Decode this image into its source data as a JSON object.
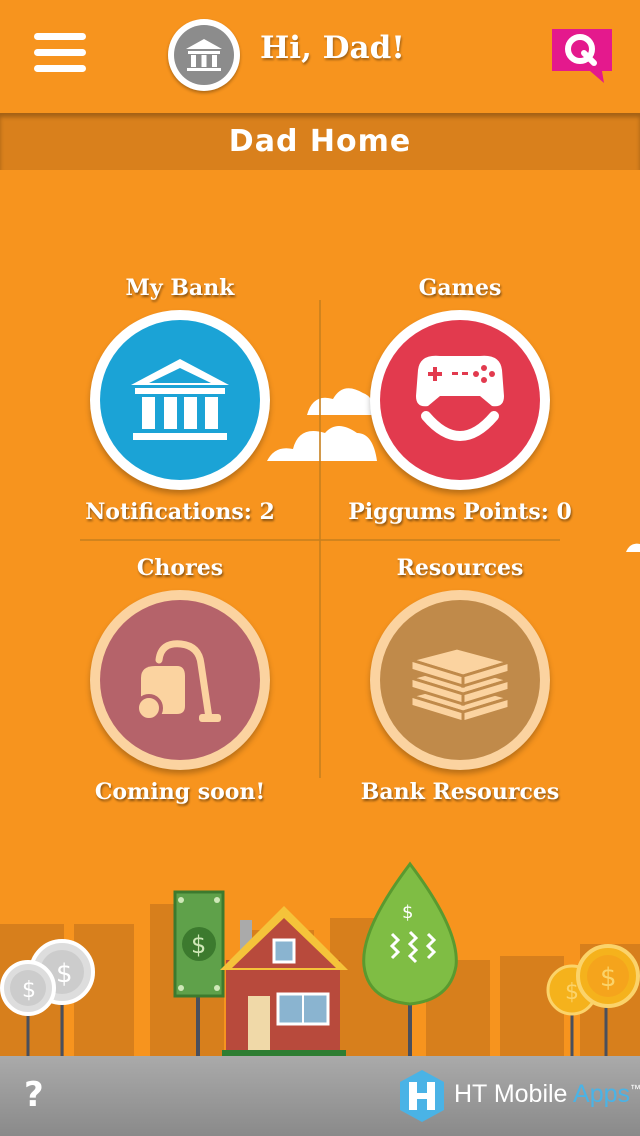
{
  "header": {
    "greeting": "Hi, Dad!",
    "menu_icon": "hamburger-menu-icon",
    "avatar_icon": "bank-building-icon",
    "q_icon": "q-chat-bubble-icon"
  },
  "page_title": "Dad Home",
  "tiles": [
    {
      "label": "My Bank",
      "sub": "Notifications: 2",
      "icon": "bank-building-icon",
      "color": "#1ba3d6"
    },
    {
      "label": "Games",
      "sub": "Piggums Points: 0",
      "icon": "game-controller-icon",
      "color": "#e23a4e"
    },
    {
      "label": "Chores",
      "sub": "Coming soon!",
      "icon": "vacuum-cleaner-icon",
      "color": "#b5636a"
    },
    {
      "label": "Resources",
      "sub": "Bank Resources",
      "icon": "books-stack-icon",
      "color": "#c08a4a"
    }
  ],
  "footer": {
    "help_label": "?",
    "brand_main": "HT Mobile ",
    "brand_accent": "Apps",
    "brand_tm": "™"
  },
  "colors": {
    "background": "#f7941e",
    "title_bar": "#d9801c",
    "q_button": "#e4198d",
    "footer": "#999999"
  }
}
